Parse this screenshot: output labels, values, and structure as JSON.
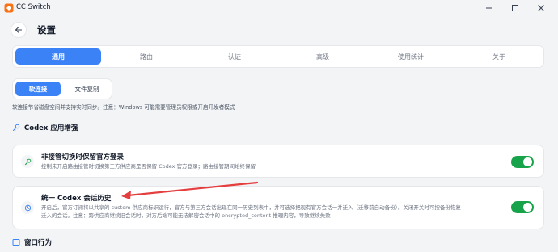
{
  "window": {
    "title": "CC Switch",
    "controls": {
      "minimize": "minimize-icon",
      "maximize": "maximize-icon",
      "close": "close-icon"
    }
  },
  "header": {
    "back_icon": "arrow-left-icon",
    "title": "设置"
  },
  "tabs": [
    {
      "label": "通用",
      "active": true
    },
    {
      "label": "路由",
      "active": false
    },
    {
      "label": "认证",
      "active": false
    },
    {
      "label": "高级",
      "active": false
    },
    {
      "label": "使用统计",
      "active": false
    },
    {
      "label": "关于",
      "active": false
    }
  ],
  "link_mode": {
    "options": [
      {
        "label": "软连接",
        "active": true
      },
      {
        "label": "文件复制",
        "active": false
      }
    ],
    "description": "软连接节省磁盘空间并支持实时同步。注意：Windows 可能需要管理员权限或开启开发者模式"
  },
  "codex_section": {
    "icon": "key-icon",
    "title": "Codex 应用增强",
    "cards": [
      {
        "icon": "key-icon",
        "title": "非接管切换时保留官方登录",
        "description": "控制未开启路由接管时切换第三方供应商是否保留 Codex 官方登录；路由接管期间始终保留",
        "enabled": true
      },
      {
        "icon": "history-icon",
        "title": "统一 Codex 会话历史",
        "description_line1": "开启后，官方订阅将以共享的 custom 供应商标识运行，官方与第三方会话出现在同一历史列表中，并可选择把现有官方会话一并迁入（迁移前自动备份）。关闭开关时可按备份恢复",
        "description_line2": "迁入的会话。注意：跨供应商继续旧会话时，对方后端可能无法解密会话中的 encrypted_content 推理内容，导致继续失败",
        "enabled": true
      }
    ]
  },
  "window_section": {
    "icon": "window-icon",
    "title": "窗口行为"
  },
  "colors": {
    "accent": "#3b82f6",
    "toggle_on": "#16a34a",
    "annotation_arrow": "#e53e3e"
  }
}
